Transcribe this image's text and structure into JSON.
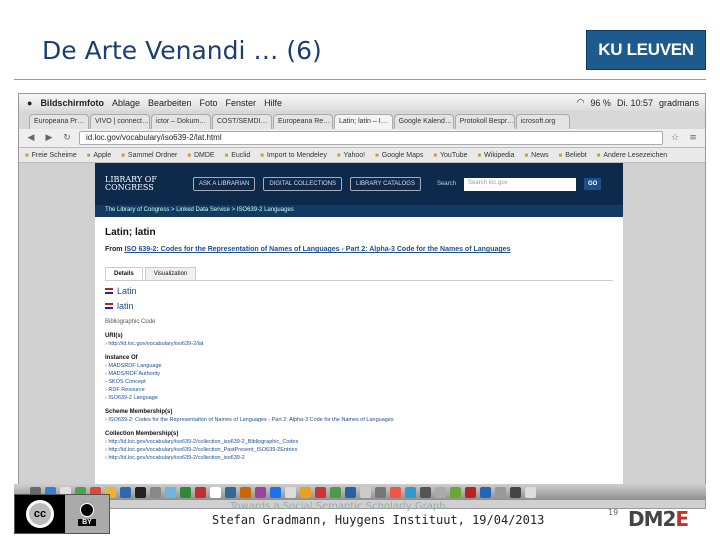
{
  "slide": {
    "title": "De Arte Venandi … (6)",
    "logo_text": "KU LEUVEN",
    "footer_text": "Stefan Gradmann, Huygens Instituut, 19/04/2013",
    "footer_overlay": "Towards a Social Semantic Scholarly Graph",
    "page_number": "19",
    "cc_label": "cc",
    "by_label": "BY",
    "partner_logo": "DM2E"
  },
  "menubar": {
    "items": [
      "Bildschirmfoto",
      "Ablage",
      "Bearbeiten",
      "Foto",
      "Fenster",
      "Hilfe"
    ],
    "battery": "96 %",
    "clock": "Di. 10:57",
    "user": "gradmans"
  },
  "browser": {
    "tabs": [
      "Europeana Pr…",
      "VIVO | connect…",
      "ictor – Dokum…",
      "COST/SEMDI…",
      "Europeana Re…",
      "Latin; latin – I…",
      "Google Kalend…",
      "Protokoll Bespr…",
      "icrosoft.org"
    ],
    "url": "id.loc.gov/vocabulary/iso639-2/lat.html",
    "bookmarks": [
      "Freie Scheime",
      "Apple",
      "Sammel Ordner",
      "DMDE",
      "Euclid",
      "Import to Mendeley",
      "Yahoo!",
      "Google Maps",
      "YouTube",
      "Wikipedia",
      "News",
      "Beliebt",
      "Andere Lesezeichen"
    ]
  },
  "loc": {
    "logo": "LIBRARY OF CONGRESS",
    "buttons": [
      "ASK A LIBRARIAN",
      "DIGITAL COLLECTIONS",
      "LIBRARY CATALOGS"
    ],
    "search_label": "Search",
    "search_placeholder": "Search loc.gov",
    "go": "GO",
    "breadcrumb": "The Library of Congress > Linked Data Service > ISO639-2 Languages",
    "heading": "Latin; latin",
    "from_prefix": "From",
    "from_link": "ISO 639-2: Codes for the Representation of Names of Languages - Part 2: Alpha-3 Code for the Names of Languages",
    "tabs": [
      "Details",
      "Visualization"
    ],
    "labels": [
      "Latin",
      "latin"
    ],
    "bibliographic_code": "Bibliographic Code",
    "uri_heading": "URI(s)",
    "uri": "http://id.loc.gov/vocabulary/iso639-2/lat",
    "instance_heading": "Instance Of",
    "instance_items": [
      "MADSRDF Language",
      "MADS/RDF Authority",
      "SKOS Concept",
      "RDF Resource",
      "ISO639-2 Language"
    ],
    "scheme_heading": "Scheme Membership(s)",
    "scheme_item": "ISO639-2: Codes for the Representation of Names of Languages - Part 2: Alpha-3 Code for the Names of Languages",
    "collection_heading": "Collection Membership(s)",
    "collection_items": [
      "http://id.loc.gov/vocabulary/iso639-2/collection_iso639-2_Bibliographic_Codes",
      "http://id.loc.gov/vocabulary/iso639-2/collection_PastPresent_ISO639-2Entries",
      "http://id.loc.gov/vocabulary/iso639-2/collection_iso639-2"
    ]
  },
  "dock_colors": [
    "#6a6a6a",
    "#3a7bd5",
    "#e0e0e0",
    "#4fa34f",
    "#d94a3a",
    "#f0b030",
    "#3366aa",
    "#222222",
    "#888888",
    "#6fb3e0",
    "#2c8a3a",
    "#c03030",
    "#ffffff",
    "#336699",
    "#cc6600",
    "#994499",
    "#1a73e8",
    "#dddddd",
    "#e8a020",
    "#cc3333",
    "#4a9a4a",
    "#2a5fa0",
    "#cccccc",
    "#777777",
    "#ee5544",
    "#3399cc",
    "#555555",
    "#aaaaaa",
    "#66aa33",
    "#bb2222",
    "#2266bb",
    "#999999",
    "#444444",
    "#dddddd"
  ]
}
